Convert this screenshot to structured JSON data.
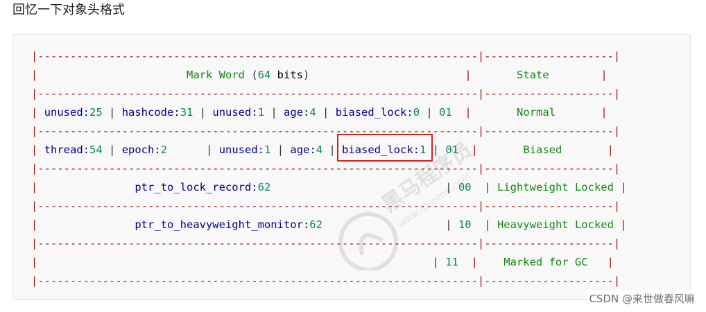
{
  "heading": "回忆一下对象头格式",
  "code": {
    "lines": [
      [
        {
          "t": "|",
          "c": "r"
        },
        {
          "t": "--------------------------------------------------------------------",
          "c": "r"
        },
        {
          "t": "|",
          "c": "r"
        },
        {
          "t": "--------------------",
          "c": "r"
        },
        {
          "t": "|",
          "c": "r"
        }
      ],
      [
        {
          "t": "|",
          "c": "r"
        },
        {
          "t": "                       ",
          "c": "p"
        },
        {
          "t": "Mark Word",
          "c": "s"
        },
        {
          "t": " (",
          "c": "p"
        },
        {
          "t": "64",
          "c": "d"
        },
        {
          "t": " ",
          "c": "p"
        },
        {
          "t": "bits",
          "c": "b"
        },
        {
          "t": ")",
          "c": "p"
        },
        {
          "t": "                        ",
          "c": "p"
        },
        {
          "t": "|",
          "c": "r"
        },
        {
          "t": "       ",
          "c": "p"
        },
        {
          "t": "State",
          "c": "s"
        },
        {
          "t": "        ",
          "c": "p"
        },
        {
          "t": "|",
          "c": "r"
        }
      ],
      [
        {
          "t": "|",
          "c": "r"
        },
        {
          "t": "--------------------------------------------------------------------",
          "c": "r"
        },
        {
          "t": "|",
          "c": "r"
        },
        {
          "t": "--------------------",
          "c": "r"
        },
        {
          "t": "|",
          "c": "r"
        }
      ],
      [
        {
          "t": "|",
          "c": "r"
        },
        {
          "t": " ",
          "c": "p"
        },
        {
          "t": "unused:",
          "c": "n"
        },
        {
          "t": "25",
          "c": "d"
        },
        {
          "t": " | ",
          "c": "p"
        },
        {
          "t": "hashcode:",
          "c": "n"
        },
        {
          "t": "31",
          "c": "d"
        },
        {
          "t": " | ",
          "c": "p"
        },
        {
          "t": "unused:",
          "c": "n"
        },
        {
          "t": "1",
          "c": "d"
        },
        {
          "t": " | ",
          "c": "p"
        },
        {
          "t": "age:",
          "c": "n"
        },
        {
          "t": "4",
          "c": "d"
        },
        {
          "t": " | ",
          "c": "p"
        },
        {
          "t": "biased_lock:",
          "c": "n"
        },
        {
          "t": "0",
          "c": "d"
        },
        {
          "t": " | ",
          "c": "p"
        },
        {
          "t": "01",
          "c": "d"
        },
        {
          "t": "  ",
          "c": "p"
        },
        {
          "t": "|",
          "c": "r"
        },
        {
          "t": "       ",
          "c": "p"
        },
        {
          "t": "Normal",
          "c": "s"
        },
        {
          "t": "       ",
          "c": "p"
        },
        {
          "t": "|",
          "c": "r"
        }
      ],
      [
        {
          "t": "|",
          "c": "r"
        },
        {
          "t": "--------------------------------------------------------------------",
          "c": "r"
        },
        {
          "t": "|",
          "c": "r"
        },
        {
          "t": "--------------------",
          "c": "r"
        },
        {
          "t": "|",
          "c": "r"
        }
      ],
      [
        {
          "t": "|",
          "c": "r"
        },
        {
          "t": " ",
          "c": "p"
        },
        {
          "t": "thread:",
          "c": "n"
        },
        {
          "t": "54",
          "c": "d"
        },
        {
          "t": " | ",
          "c": "p"
        },
        {
          "t": "epoch:",
          "c": "n"
        },
        {
          "t": "2",
          "c": "d"
        },
        {
          "t": "      | ",
          "c": "p"
        },
        {
          "t": "unused:",
          "c": "n"
        },
        {
          "t": "1",
          "c": "d"
        },
        {
          "t": " | ",
          "c": "p"
        },
        {
          "t": "age:",
          "c": "n"
        },
        {
          "t": "4",
          "c": "d"
        },
        {
          "t": " | ",
          "c": "p"
        },
        {
          "t": "biased_lock:",
          "c": "n"
        },
        {
          "t": "1",
          "c": "d"
        },
        {
          "t": " | ",
          "c": "p"
        },
        {
          "t": "01",
          "c": "d"
        },
        {
          "t": "  ",
          "c": "p"
        },
        {
          "t": "|",
          "c": "r"
        },
        {
          "t": "       ",
          "c": "p"
        },
        {
          "t": "Biased",
          "c": "s"
        },
        {
          "t": "       ",
          "c": "p"
        },
        {
          "t": "|",
          "c": "r"
        }
      ],
      [
        {
          "t": "|",
          "c": "r"
        },
        {
          "t": "--------------------------------------------------------------------",
          "c": "r"
        },
        {
          "t": "|",
          "c": "r"
        },
        {
          "t": "--------------------",
          "c": "r"
        },
        {
          "t": "|",
          "c": "r"
        }
      ],
      [
        {
          "t": "|",
          "c": "r"
        },
        {
          "t": "               ",
          "c": "p"
        },
        {
          "t": "ptr_to_lock_record:",
          "c": "n"
        },
        {
          "t": "62",
          "c": "d"
        },
        {
          "t": "                           | ",
          "c": "p"
        },
        {
          "t": "00",
          "c": "d"
        },
        {
          "t": "  ",
          "c": "p"
        },
        {
          "t": "|",
          "c": "r"
        },
        {
          "t": " ",
          "c": "p"
        },
        {
          "t": "Lightweight Locked",
          "c": "s"
        },
        {
          "t": " ",
          "c": "p"
        },
        {
          "t": "|",
          "c": "r"
        }
      ],
      [
        {
          "t": "|",
          "c": "r"
        },
        {
          "t": "--------------------------------------------------------------------",
          "c": "r"
        },
        {
          "t": "|",
          "c": "r"
        },
        {
          "t": "--------------------",
          "c": "r"
        },
        {
          "t": "|",
          "c": "r"
        }
      ],
      [
        {
          "t": "|",
          "c": "r"
        },
        {
          "t": "               ",
          "c": "p"
        },
        {
          "t": "ptr_to_heavyweight_monitor:",
          "c": "n"
        },
        {
          "t": "62",
          "c": "d"
        },
        {
          "t": "                   | ",
          "c": "p"
        },
        {
          "t": "10",
          "c": "d"
        },
        {
          "t": "  ",
          "c": "p"
        },
        {
          "t": "|",
          "c": "r"
        },
        {
          "t": " ",
          "c": "p"
        },
        {
          "t": "Heavyweight Locked",
          "c": "s"
        },
        {
          "t": " ",
          "c": "p"
        },
        {
          "t": "|",
          "c": "r"
        }
      ],
      [
        {
          "t": "|",
          "c": "r"
        },
        {
          "t": "--------------------------------------------------------------------",
          "c": "r"
        },
        {
          "t": "|",
          "c": "r"
        },
        {
          "t": "--------------------",
          "c": "r"
        },
        {
          "t": "|",
          "c": "r"
        }
      ],
      [
        {
          "t": "|",
          "c": "r"
        },
        {
          "t": "                                                             | ",
          "c": "p"
        },
        {
          "t": "11",
          "c": "d"
        },
        {
          "t": "  ",
          "c": "p"
        },
        {
          "t": "|",
          "c": "r"
        },
        {
          "t": "    ",
          "c": "p"
        },
        {
          "t": "Marked for GC",
          "c": "s"
        },
        {
          "t": "   ",
          "c": "p"
        },
        {
          "t": "|",
          "c": "r"
        }
      ],
      [
        {
          "t": "|",
          "c": "r"
        },
        {
          "t": "--------------------------------------------------------------------",
          "c": "r"
        },
        {
          "t": "|",
          "c": "r"
        },
        {
          "t": "--------------------",
          "c": "r"
        },
        {
          "t": "|",
          "c": "r"
        }
      ]
    ]
  },
  "watermark": {
    "text_cn": "黑马程序员",
    "text_url": "www.itheima.com"
  },
  "credit": "CSDN @来世做春风嘛",
  "colors": {
    "highlight_border": "#d9201a",
    "border_chars": "#a31515",
    "field_names": "#000088",
    "numbers": "#098658",
    "strings": "#118811"
  }
}
